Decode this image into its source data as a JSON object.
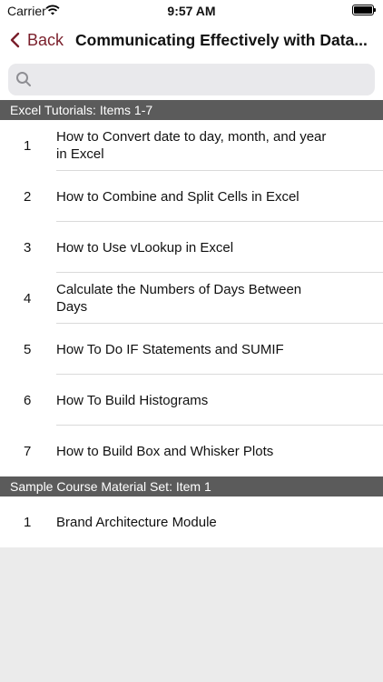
{
  "status_bar": {
    "carrier": "Carrier",
    "time": "9:57 AM"
  },
  "nav": {
    "back_label": "Back",
    "title": "Communicating Effectively with Data...",
    "accent_color": "#7a1f2b"
  },
  "search": {
    "placeholder": ""
  },
  "sections": [
    {
      "header": "Excel Tutorials: Items 1-7",
      "items": [
        {
          "number": "1",
          "title": "How to Convert date to day, month, and year in Excel"
        },
        {
          "number": "2",
          "title": "How to Combine and Split Cells in Excel"
        },
        {
          "number": "3",
          "title": "How to Use vLookup in Excel"
        },
        {
          "number": "4",
          "title": "Calculate the Numbers of Days Between Days"
        },
        {
          "number": "5",
          "title": "How To Do IF Statements and SUMIF"
        },
        {
          "number": "6",
          "title": "How To Build Histograms"
        },
        {
          "number": "7",
          "title": "How to Build Box and Whisker Plots"
        }
      ]
    },
    {
      "header": "Sample Course Material Set: Item 1",
      "items": [
        {
          "number": "1",
          "title": "Brand Architecture Module"
        }
      ]
    }
  ]
}
